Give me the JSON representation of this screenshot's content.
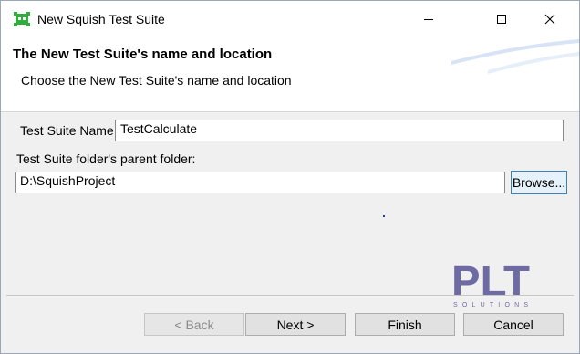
{
  "window": {
    "title": "New Squish Test Suite",
    "icons": {
      "app": "squish-app-icon",
      "minimize": "minimize-icon",
      "maximize": "maximize-icon",
      "close": "close-icon"
    }
  },
  "header": {
    "title": "The New Test Suite's name and location",
    "description": "Choose the New Test Suite's name and location"
  },
  "form": {
    "name_label": "Test Suite Name:",
    "name_value": "TestCalculate",
    "parent_label": "Test Suite folder's parent folder:",
    "parent_value": "D:\\SquishProject",
    "browse_label": "Browse..."
  },
  "watermark": {
    "brand": "PLT",
    "sub": "SOLUTIONS"
  },
  "buttons": {
    "back": "< Back",
    "next": "Next >",
    "finish": "Finish",
    "cancel": "Cancel"
  },
  "colors": {
    "accent": "#3c7fb1",
    "watermark": "#6e6aa3",
    "icon_green": "#2fae3c"
  }
}
